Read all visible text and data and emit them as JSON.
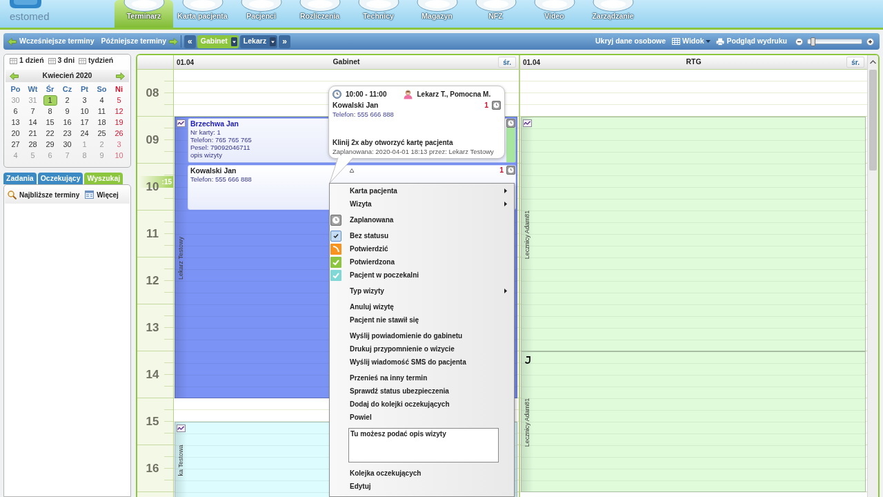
{
  "logo": {
    "text": "estomed"
  },
  "nav": [
    {
      "label": "Terminarz",
      "selected": true
    },
    {
      "label": "Karta pacjenta",
      "selected": false
    },
    {
      "label": "Pacjenci",
      "selected": false
    },
    {
      "label": "Rozliczenia",
      "selected": false
    },
    {
      "label": "Technicy",
      "selected": false
    },
    {
      "label": "Magazyn",
      "selected": false
    },
    {
      "label": "NFZ",
      "selected": false
    },
    {
      "label": "Video",
      "selected": false
    },
    {
      "label": "Zarządzanie",
      "selected": false
    }
  ],
  "toolbar": {
    "earlier": "Wcześniejsze terminy",
    "later": "Późniejsze terminy",
    "prev": "«",
    "next": "»",
    "views": [
      {
        "label": "Gabinet",
        "selected": true
      },
      {
        "label": "Lekarz",
        "selected": false
      }
    ],
    "hide_personal": "Ukryj dane osobowe",
    "view": "Widok",
    "print_preview": "Podgląd wydruku",
    "zoom": {
      "level": 0.05
    }
  },
  "sidebar": {
    "ranges": [
      "1 dzień",
      "3 dni",
      "tydzień"
    ],
    "month": "Kwiecień 2020",
    "weekdays": [
      "Po",
      "Wt",
      "Śr",
      "Cz",
      "Pt",
      "So",
      "Ni"
    ],
    "weeks": [
      [
        {
          "day": "30",
          "muted": true,
          "selected": false
        },
        {
          "day": "31",
          "muted": true,
          "selected": false
        },
        {
          "day": "1",
          "muted": false,
          "selected": true
        },
        {
          "day": "2",
          "muted": false,
          "selected": false
        },
        {
          "day": "3",
          "muted": false,
          "selected": false
        },
        {
          "day": "4",
          "muted": false,
          "selected": false
        },
        {
          "day": "5",
          "muted": false,
          "selected": false
        }
      ],
      [
        {
          "day": "6",
          "muted": false,
          "selected": false
        },
        {
          "day": "7",
          "muted": false,
          "selected": false
        },
        {
          "day": "8",
          "muted": false,
          "selected": false
        },
        {
          "day": "9",
          "muted": false,
          "selected": false
        },
        {
          "day": "10",
          "muted": false,
          "selected": false
        },
        {
          "day": "11",
          "muted": false,
          "selected": false
        },
        {
          "day": "12",
          "muted": false,
          "selected": false
        }
      ],
      [
        {
          "day": "13",
          "muted": false,
          "selected": false
        },
        {
          "day": "14",
          "muted": false,
          "selected": false
        },
        {
          "day": "15",
          "muted": false,
          "selected": false
        },
        {
          "day": "16",
          "muted": false,
          "selected": false
        },
        {
          "day": "17",
          "muted": false,
          "selected": false
        },
        {
          "day": "18",
          "muted": false,
          "selected": false
        },
        {
          "day": "19",
          "muted": false,
          "selected": false
        }
      ],
      [
        {
          "day": "20",
          "muted": false,
          "selected": false
        },
        {
          "day": "21",
          "muted": false,
          "selected": false
        },
        {
          "day": "22",
          "muted": false,
          "selected": false
        },
        {
          "day": "23",
          "muted": false,
          "selected": false
        },
        {
          "day": "24",
          "muted": false,
          "selected": false
        },
        {
          "day": "25",
          "muted": false,
          "selected": false
        },
        {
          "day": "26",
          "muted": false,
          "selected": false
        }
      ],
      [
        {
          "day": "27",
          "muted": false,
          "selected": false
        },
        {
          "day": "28",
          "muted": false,
          "selected": false
        },
        {
          "day": "29",
          "muted": false,
          "selected": false
        },
        {
          "day": "30",
          "muted": false,
          "selected": false
        },
        {
          "day": "1",
          "muted": true,
          "selected": false
        },
        {
          "day": "2",
          "muted": true,
          "selected": false
        },
        {
          "day": "3",
          "muted": true,
          "selected": false
        }
      ],
      [
        {
          "day": "4",
          "muted": true,
          "selected": false
        },
        {
          "day": "5",
          "muted": true,
          "selected": false
        },
        {
          "day": "6",
          "muted": true,
          "selected": false
        },
        {
          "day": "7",
          "muted": true,
          "selected": false
        },
        {
          "day": "8",
          "muted": true,
          "selected": false
        },
        {
          "day": "9",
          "muted": true,
          "selected": false
        },
        {
          "day": "10",
          "muted": true,
          "selected": false
        }
      ]
    ],
    "tabs": [
      {
        "label": "Zadania",
        "selected": false
      },
      {
        "label": "Oczekujący",
        "selected": false
      },
      {
        "label": "Wyszukaj",
        "selected": true
      }
    ],
    "actions": [
      "Najbliższe terminy",
      "Więcej"
    ]
  },
  "schedule": {
    "hours": [
      {
        "label": "08"
      },
      {
        "label": "09"
      },
      {
        "label": "10",
        "marker": ":15"
      },
      {
        "label": "11"
      },
      {
        "label": "12"
      },
      {
        "label": "13"
      },
      {
        "label": "14"
      },
      {
        "label": "15"
      },
      {
        "label": "16"
      }
    ],
    "columns": [
      {
        "date": "01.04",
        "name": "Gabinet",
        "weekday": "śr.",
        "blocks": [
          {
            "kind": "nfz",
            "staff": "Lekarz Testowy",
            "color": "#7b93f5",
            "appointments": [
              {
                "patient": "Brzechwa Jan",
                "selected": false,
                "color": "#a8e6a0",
                "details": [
                  "Nr karty: 1",
                  "Telefon: 765 765 765",
                  "Pesel: 79092046711",
                  "opis wizyty"
                ]
              },
              {
                "patient": "Kowalski Jan",
                "selected": true,
                "count": "1",
                "details": [
                  "Telefon: 555 666 888"
                ]
              }
            ]
          },
          {
            "kind": "nfz",
            "staff": "ka Testowa",
            "color": "#dcfcfd"
          }
        ]
      },
      {
        "date": "01.04",
        "name": "RTG",
        "weekday": "śr.",
        "blocks": [
          {
            "kind": "nfz",
            "staff": "Lecznicy Adam81",
            "color": "#dffbda"
          },
          {
            "kind": "other",
            "staff": "Lecznicy Adam81",
            "color": "#dffbda"
          }
        ]
      }
    ]
  },
  "tooltip": {
    "time": "10:00 - 11:00",
    "staff": "Lekarz T., Pomocna M.",
    "patient": "Kowalski Jan",
    "count": "1",
    "phone": "Telefon: 555 666 888",
    "hint": "Klinij 2x aby otworzyć kartę pacjenta",
    "created": "Zaplanowana: 2020-04-01 18:13 przez: Lekarz Testowy"
  },
  "context_menu": {
    "groups": [
      {
        "items": [
          {
            "label": "Karta pacjenta",
            "kind": "submenu"
          },
          {
            "label": "Wizyta",
            "kind": "submenu"
          }
        ]
      },
      {
        "items": [
          {
            "label": "Zaplanowana",
            "kind": "scheduled"
          }
        ]
      },
      {
        "items": [
          {
            "label": "Bez statusu",
            "kind": "status",
            "selected": true,
            "color": "#c3dcf4"
          },
          {
            "label": "Potwierdzić",
            "kind": "request",
            "selected": false,
            "color": "#f7931e"
          },
          {
            "label": "Potwierdzona",
            "kind": "status",
            "selected": false,
            "color": "#8cc63f"
          },
          {
            "label": "Pacjent w poczekalni",
            "kind": "status",
            "selected": false,
            "color": "#7fd8d6"
          }
        ]
      },
      {
        "items": [
          {
            "label": "Typ wizyty",
            "kind": "submenu"
          }
        ]
      },
      {
        "items": [
          {
            "label": "Anuluj wizytę",
            "kind": "action"
          },
          {
            "label": "Pacjent nie stawił się",
            "kind": "action"
          }
        ]
      },
      {
        "items": [
          {
            "label": "Wyślij powiadomienie do gabinetu",
            "kind": "action"
          },
          {
            "label": "Drukuj przypomnienie o wizycie",
            "kind": "action"
          },
          {
            "label": "Wyślij wiadomość SMS do pacjenta",
            "kind": "action"
          }
        ]
      },
      {
        "items": [
          {
            "label": "Przenieś na inny termin",
            "kind": "action"
          },
          {
            "label": "Sprawdź status ubezpieczenia",
            "kind": "action"
          },
          {
            "label": "Dodaj do kolejki oczekujących",
            "kind": "action"
          },
          {
            "label": "Powiel",
            "kind": "action"
          }
        ]
      },
      {
        "field": {
          "placeholder": "Tu możesz podać opis wizyty"
        }
      },
      {
        "items": [
          {
            "label": "Kolejka oczekujących",
            "kind": "action"
          },
          {
            "label": "Edytuj",
            "kind": "action"
          }
        ]
      }
    ]
  }
}
